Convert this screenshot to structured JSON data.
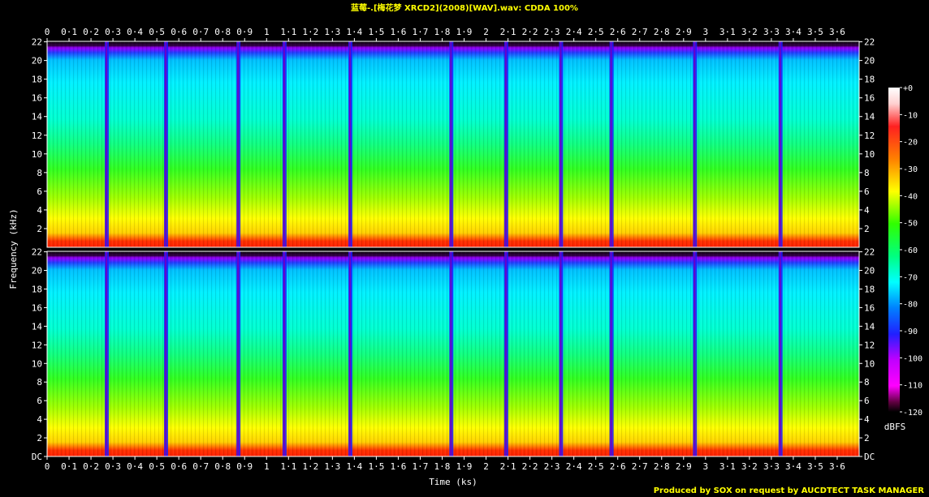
{
  "title": "蓝莓-.[梅花梦 XRCD2](2008)[WAV].wav: CDDA 100%",
  "footer": "Produced by SOX on request by AUCDTECT TASK MANAGER",
  "chart_data": {
    "type": "heatmap",
    "subtype": "spectrogram",
    "title": "蓝莓-.[梅花梦 XRCD2](2008)[WAV].wav: CDDA 100%",
    "xlabel": "Time (ks)",
    "ylabel": "Frequency (kHz)",
    "xlim": [
      0,
      3.7
    ],
    "ylim": [
      0,
      22.05
    ],
    "x_tick_labels": [
      "0",
      "0·1",
      "0·2",
      "0·3",
      "0·4",
      "0·5",
      "0·6",
      "0·7",
      "0·8",
      "0·9",
      "1",
      "1·1",
      "1·2",
      "1·3",
      "1·4",
      "1·5",
      "1·6",
      "1·7",
      "1·8",
      "1·9",
      "2",
      "2·1",
      "2·2",
      "2·3",
      "2·4",
      "2·5",
      "2·6",
      "2·7",
      "2·8",
      "2·9",
      "3",
      "3·1",
      "3·2",
      "3·3",
      "3·4",
      "3·5",
      "3·6"
    ],
    "y_tick_labels": [
      "DC",
      "2",
      "4",
      "6",
      "8",
      "10",
      "12",
      "14",
      "16",
      "18",
      "20",
      "22"
    ],
    "channels": [
      "left",
      "right"
    ],
    "track_boundaries_ks": [
      0.27,
      0.54,
      0.87,
      1.08,
      1.38,
      1.84,
      2.09,
      2.34,
      2.57,
      2.95,
      3.34
    ],
    "colorbar": {
      "label": "dBFS",
      "tick_labels": [
        "+0",
        "-10",
        "-20",
        "-30",
        "-40",
        "-50",
        "-60",
        "-70",
        "-80",
        "-90",
        "-100",
        "-110",
        "-120"
      ],
      "range": [
        -120,
        0
      ]
    },
    "lowpass_cutoff_khz": 21.5
  }
}
